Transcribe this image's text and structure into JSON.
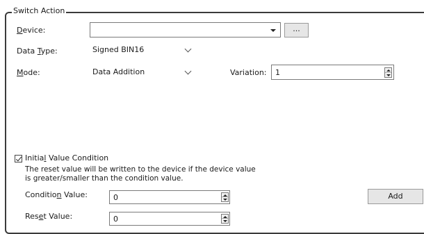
{
  "group": {
    "title": "Switch Action"
  },
  "device": {
    "label_pre": "",
    "label_key": "D",
    "label_post": "evice:",
    "value": "",
    "browse_label": "..."
  },
  "data_type": {
    "label_pre": "Data ",
    "label_key": "T",
    "label_post": "ype:",
    "value": "Signed BIN16"
  },
  "mode": {
    "label_pre": "",
    "label_key": "M",
    "label_post": "ode:",
    "value": "Data Addition"
  },
  "variation": {
    "label": "Variation:",
    "value": "1"
  },
  "initial_condition": {
    "checked": true,
    "label_pre": "Initia",
    "label_key": "l",
    "label_post": " Value Condition",
    "description_line1": "The reset value will be written to the device if the device value",
    "description_line2": "is greater/smaller than the condition value."
  },
  "condition_value": {
    "label_pre": "Conditio",
    "label_key": "n",
    "label_post": " Value:",
    "value": "0"
  },
  "reset_value": {
    "label_pre": "Res",
    "label_key": "e",
    "label_post": "t Value:",
    "value": "0"
  },
  "add_button": {
    "label": "Add"
  }
}
